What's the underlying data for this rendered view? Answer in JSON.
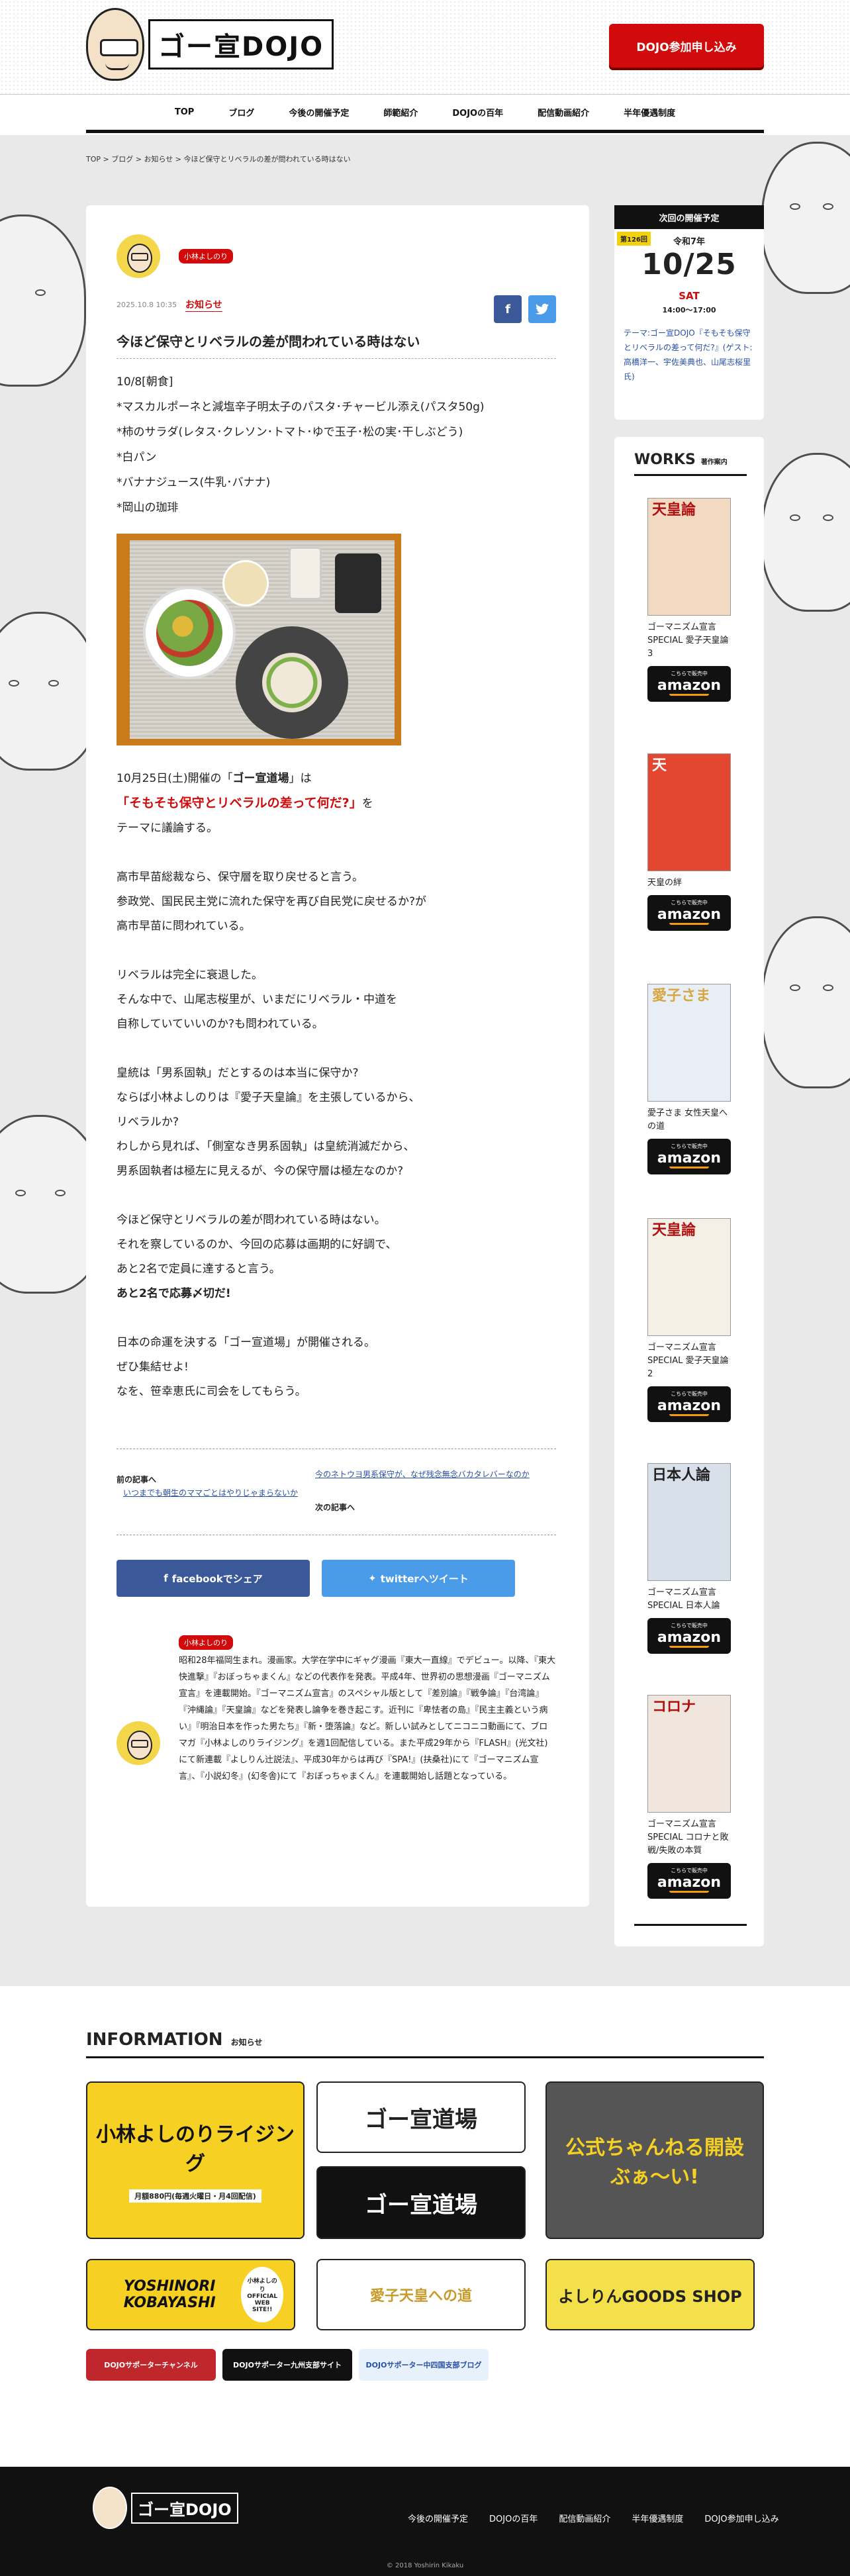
{
  "header": {
    "logo_text": "ゴー宣DOJO",
    "join_button": "DOJO参加申し込み"
  },
  "nav": {
    "items": [
      "TOP",
      "ブログ",
      "今後の開催予定",
      "師範紹介",
      "DOJOの百年",
      "配信動画紹介",
      "半年優遇制度"
    ]
  },
  "breadcrumb": {
    "items": [
      "TOP",
      ">",
      "ブログ",
      ">",
      "お知らせ",
      ">",
      "今ほど保守とリベラルの差が問われている時はない"
    ]
  },
  "article": {
    "author_tag": "小林よしのり",
    "date": "2025.10.8 10:35",
    "category": "お知らせ",
    "title": "今ほど保守とリベラルの差が問われている時はない",
    "breakfast": [
      "10/8[朝食]",
      "*マスカルポーネと減塩辛子明太子のパスタ･チャービル添え(パスタ50g)",
      "*柿のサラダ(レタス･クレソン･トマト･ゆで玉子･松の実･干しぶどう)",
      "*白パン",
      "*バナナジュース(牛乳･バナナ)",
      "*岡山の珈琲"
    ],
    "p1_pre": "10月25日(土)開催の「",
    "p1_bold": "ゴー宣道場",
    "p1_post": "」は",
    "p1_red": "「そもそも保守とリベラルの差って何だ?」",
    "p1_tail": "を",
    "p1_line3": "テーマに議論する。",
    "p2": [
      "高市早苗総裁なら、保守層を取り戻せると言う。",
      "参政党、国民民主党に流れた保守を再び自民党に戻せるか?が",
      "高市早苗に問われている。"
    ],
    "p3": [
      "リベラルは完全に衰退した。",
      "そんな中で、山尾志桜里が、いまだにリベラル・中道を",
      "自称していていいのか?も問われている。"
    ],
    "p4": [
      "皇統は「男系固執」だとするのは本当に保守か?",
      "ならば小林よしのりは『愛子天皇論』を主張しているから、",
      "リベラルか?",
      "わしから見れば、「側室なき男系固執」は皇統消滅だから、",
      "男系固執者は極左に見えるが、今の保守層は極左なのか?"
    ],
    "p5": [
      "今ほど保守とリベラルの差が問われている時はない。",
      "それを察しているのか、今回の応募は画期的に好調で、",
      "あと2名で定員に達すると言う。"
    ],
    "p5_bold": "あと2名で応募〆切だ!",
    "p6": [
      "日本の命運を決する「ゴー宣道場」が開催される。",
      "ぜひ集結せよ!",
      "なを、笹幸恵氏に司会をしてもらう。"
    ],
    "prev_label": "前の記事へ",
    "prev_title": "いつまでも朝生のママごとはやりじゃまらないか",
    "next_title": "今のネトウヨ男系保守が、なぜ残念無念バカタレバーなのか",
    "next_label": "次の記事へ",
    "fb_share": "facebookでシェア",
    "tw_share": "twitterへツイート",
    "author_bio": "昭和28年福岡生まれ。漫画家。大学在学中にギャグ漫画『東大一直線』でデビュー。以降、『東大快進撃』『おぼっちゃまくん』などの代表作を発表。平成4年、世界初の思想漫画『ゴーマニズム宣言』を連載開始。『ゴーマニズム宣言』のスペシャル版として『差別論』『戦争論』『台湾論』『沖縄論』『天皇論』などを発表し論争を巻き起こす。近刊に『卑怯者の島』『民主主義という病い』『明治日本を作った男たち』『新・堕落論』など。新しい試みとしてニコニコ動画にて、ブロマガ『小林よしのりライジング』を週1回配信している。また平成29年から『FLASH』(光文社)にて新連載『よしりん辻説法』、平成30年からは再び『SPA!』(扶桑社)にて『ゴーマニズム宣言』、『小説幻冬』(幻冬舎)にて『おぼっちゃまくん』を連載開始し話題となっている。"
  },
  "next_event": {
    "head": "次回の開催予定",
    "badge": "第126回",
    "year": "令和7年",
    "date": "10/25",
    "day": "SAT",
    "time": "14:00〜17:00",
    "theme": "テーマ:ゴー宣DOJO『そもそも保守とリベラルの差って何だ?』(ゲスト:高橋洋一、宇佐美典也、山尾志桜里氏)"
  },
  "works": {
    "heading": "WORKS",
    "sub": "著作案内",
    "amazon_small": "こちらで販売中",
    "amazon": "amazon",
    "books": [
      {
        "cover": "天皇論",
        "title": "ゴーマニズム宣言SPECIAL 愛子天皇論3",
        "color": "#f2d9c2"
      },
      {
        "cover": "天",
        "title": "天皇の絆",
        "color": "#e4472f"
      },
      {
        "cover": "愛子さま",
        "title": "愛子さま 女性天皇への道",
        "color": "#e8eef6"
      },
      {
        "cover": "天皇論",
        "title": "ゴーマニズム宣言SPECIAL 愛子天皇論2",
        "color": "#f5f0e6"
      },
      {
        "cover": "日本人論",
        "title": "ゴーマニズム宣言SPECIAL 日本人論",
        "color": "#d8e0ea"
      },
      {
        "cover": "コロナ",
        "title": "ゴーマニズム宣言SPECIAL コロナと敗戦/失敗の本質",
        "color": "#f0e6de"
      }
    ]
  },
  "info": {
    "heading": "INFORMATION",
    "sub": "お知らせ",
    "banners": [
      "小林よしのりライジング",
      "月額880円(毎週火曜日・月4回配信)",
      "ゴー宣道場",
      "ゴー宣道場",
      "公式ちゃんねる開設ぶぁ〜い!",
      "YOSHINORI KOBAYASHI",
      "小林よしのりOFFICIAL WEB SITE!!",
      "愛子天皇への道",
      "よしりんGOODS SHOP"
    ],
    "small": [
      "DOJOサポーターチャンネル",
      "DOJOサポーター九州支部サイト",
      "DOJOサポーター中四国支部ブログ"
    ]
  },
  "footer": {
    "logo_text": "ゴー宣DOJO",
    "nav": [
      "今後の開催予定",
      "DOJOの百年",
      "配信動画紹介",
      "半年優遇制度",
      "DOJO参加申し込み"
    ],
    "copyright": "© 2018 Yoshirin Kikaku"
  }
}
